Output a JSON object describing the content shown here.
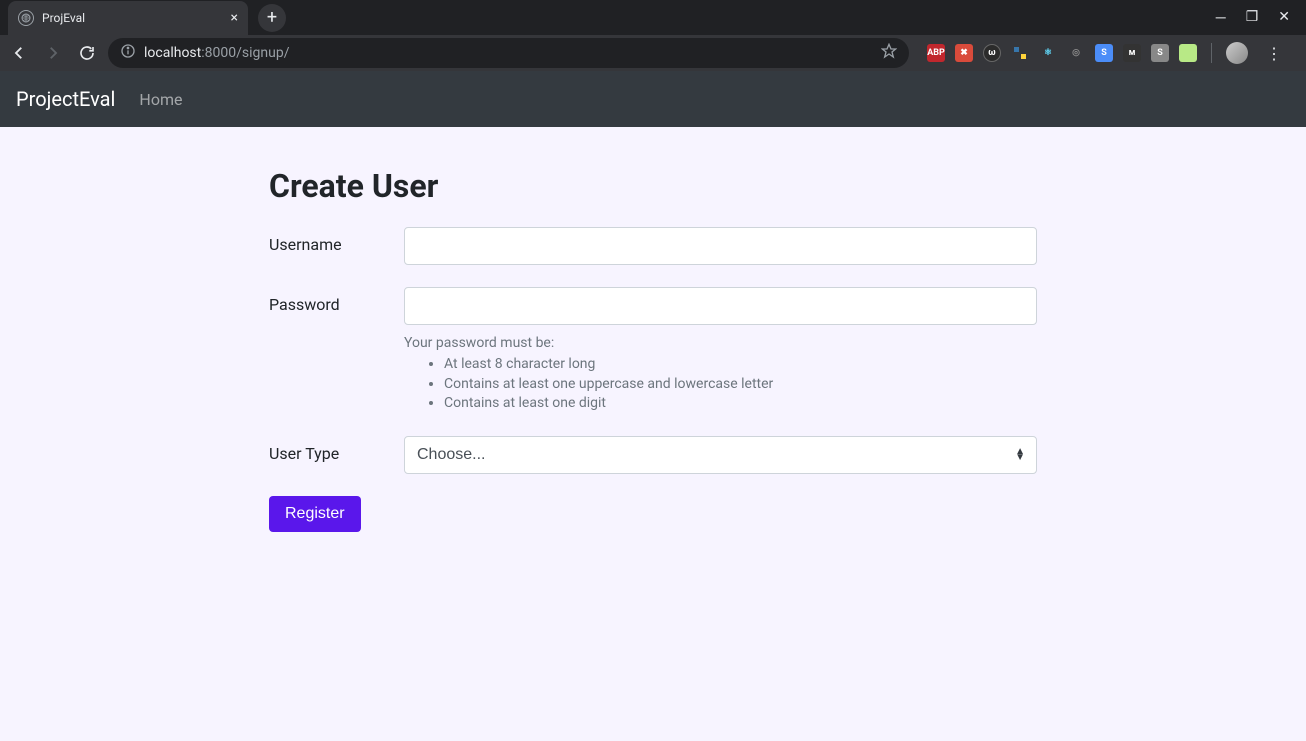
{
  "browser": {
    "tab_title": "ProjEval",
    "url_host": "localhost",
    "url_port_path": ":8000/signup/"
  },
  "navbar": {
    "brand": "ProjectEval",
    "home": "Home"
  },
  "page": {
    "title": "Create User"
  },
  "form": {
    "username_label": "Username",
    "password_label": "Password",
    "password_help_intro": "Your password must be:",
    "password_rules": {
      "r0": "At least 8 character long",
      "r1": "Contains at least one uppercase and lowercase letter",
      "r2": "Contains at least one digit"
    },
    "usertype_label": "User Type",
    "usertype_selected": "Choose...",
    "register_label": "Register"
  }
}
